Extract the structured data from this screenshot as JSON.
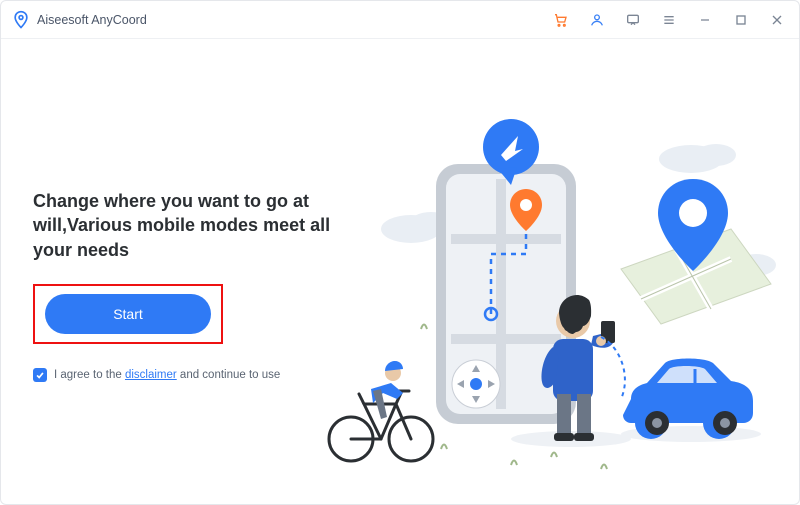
{
  "titlebar": {
    "app_title": "Aiseesoft AnyCoord",
    "icons": {
      "cart": "cart-icon",
      "user": "user-icon",
      "feedback": "feedback-icon",
      "menu": "menu-icon",
      "minimize": "minimize-icon",
      "maximize": "maximize-icon",
      "close": "close-icon"
    }
  },
  "main": {
    "headline": "Change where you want to go at will,Various mobile modes meet all your needs",
    "start_label": "Start",
    "agree_prefix": "I agree to the ",
    "agree_link": "disclaimer",
    "agree_suffix": " and continue to use",
    "agree_checked": true
  },
  "colors": {
    "accent": "#2f7af5",
    "highlight_border": "#e11",
    "cart": "#ff7a2f"
  }
}
